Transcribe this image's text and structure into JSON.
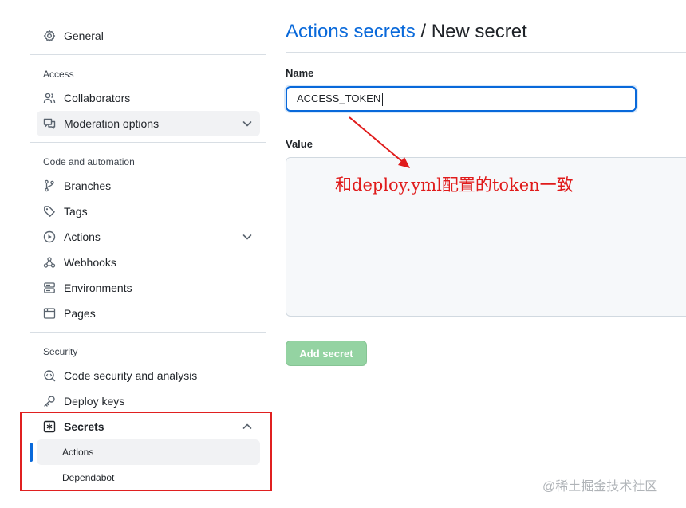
{
  "sidebar": {
    "general": "General",
    "sections": {
      "access": "Access",
      "code_automation": "Code and automation",
      "security": "Security"
    },
    "items": {
      "collaborators": "Collaborators",
      "moderation": "Moderation options",
      "branches": "Branches",
      "tags": "Tags",
      "actions": "Actions",
      "webhooks": "Webhooks",
      "environments": "Environments",
      "pages": "Pages",
      "code_security": "Code security and analysis",
      "deploy_keys": "Deploy keys",
      "secrets": "Secrets",
      "secrets_actions": "Actions",
      "secrets_dependabot": "Dependabot"
    }
  },
  "main": {
    "breadcrumb_link": "Actions secrets",
    "breadcrumb_sep": " / ",
    "breadcrumb_current": "New secret",
    "name_label": "Name",
    "name_value": "ACCESS_TOKEN",
    "value_label": "Value",
    "value_value": "",
    "add_button": "Add secret"
  },
  "annotation": {
    "text": "和deploy.yml配置的token一致",
    "color": "#e01b1b"
  },
  "watermark": "@稀土掘金技术社区",
  "colors": {
    "accent": "#0969da",
    "button_disabled": "#94d3a2",
    "highlight_box": "#e02020"
  }
}
